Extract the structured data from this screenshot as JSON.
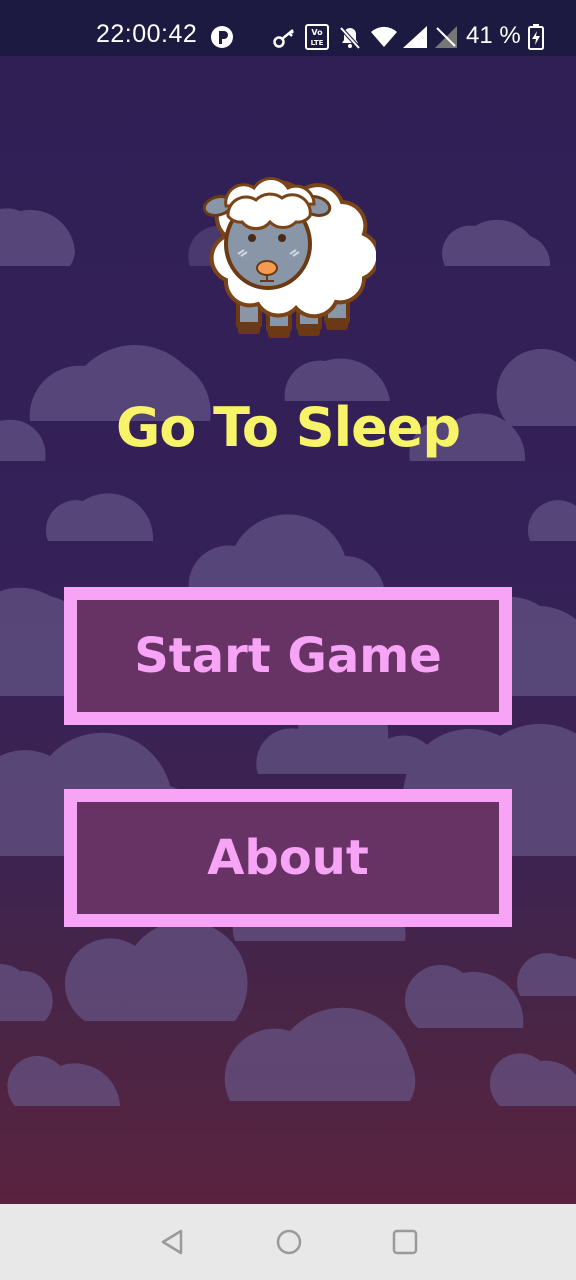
{
  "status_bar": {
    "time": "22:00:42",
    "battery_percent": "41 %",
    "icons": [
      "app-notification-icon",
      "key-icon",
      "volte-icon",
      "mute-icon",
      "wifi-icon",
      "signal-icon",
      "signal-icon-2",
      "battery-charging-icon"
    ]
  },
  "game": {
    "title": "Go To Sleep",
    "start_label": "Start Game",
    "about_label": "About",
    "mascot": "sheep-icon"
  },
  "nav_bar": {
    "icons": [
      "back-icon",
      "home-icon",
      "recents-icon"
    ]
  },
  "colors": {
    "title": "#f8f46a",
    "button_fill": "#673365",
    "button_border": "#f8a4f6",
    "status_bar": "#1c1a40",
    "nav_bar": "#e8e8e8"
  }
}
